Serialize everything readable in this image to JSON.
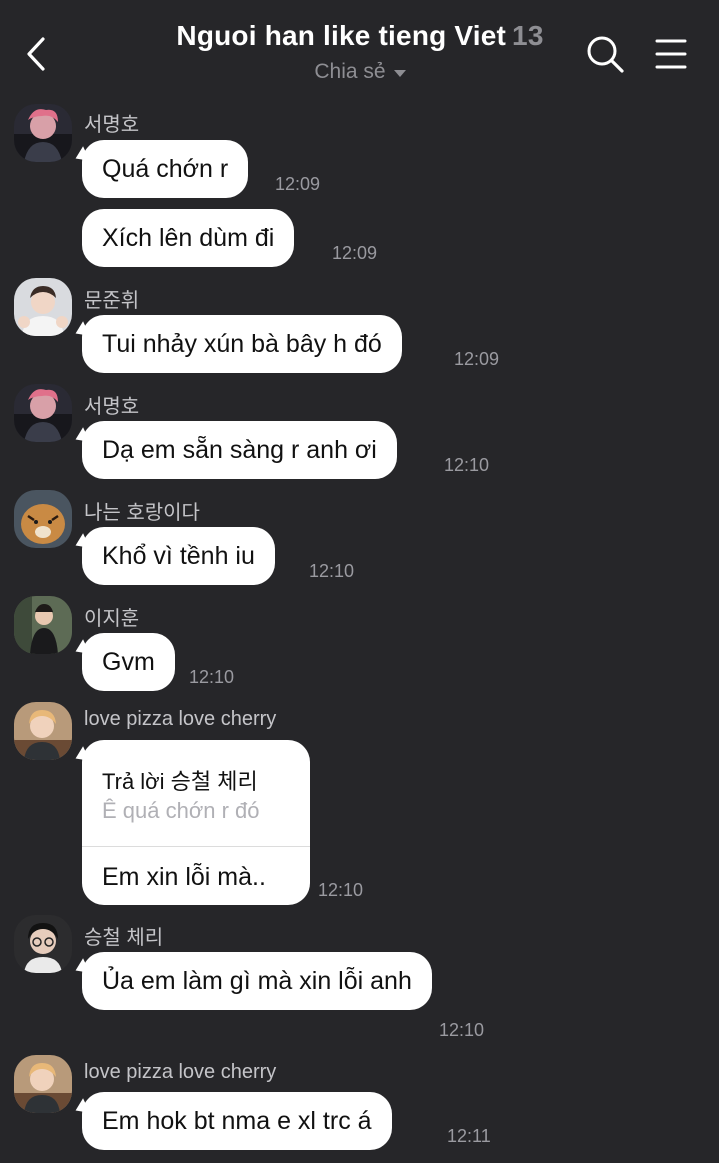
{
  "header": {
    "title": "Nguoi han like tieng Viet",
    "member_count": "13",
    "subtitle": "Chia sẻ",
    "icons": [
      "back-arrow-icon",
      "search-icon",
      "menu-icon"
    ]
  },
  "messages": [
    {
      "sender": "서명호",
      "text": "Quá chớn r",
      "time": "12:09"
    },
    {
      "text": "Xích lên dùm đi",
      "time": "12:09"
    },
    {
      "sender": "문준휘",
      "text": "Tui nhảy xún bà bây h đó",
      "time": "12:09"
    },
    {
      "sender": "서명호",
      "text": "Dạ em sẵn sàng r anh ơi",
      "time": "12:10"
    },
    {
      "sender": "나는 호랑이다",
      "text": "Khổ vì tềnh iu",
      "time": "12:10"
    },
    {
      "sender": "이지훈",
      "text": "Gvm",
      "time": "12:10"
    },
    {
      "sender": "love pizza love cherry",
      "reply_to": "Trả lời 승철 체리",
      "reply_quote": "Ê quá chớn r đó",
      "text": "Em xin lỗi mà..",
      "time": "12:10"
    },
    {
      "sender": "승철 체리",
      "text": "Ủa em làm gì mà xin lỗi anh",
      "time": "12:10"
    },
    {
      "sender": "love pizza love cherry",
      "text": "Em hok bt nma e xl trc á",
      "time": "12:11"
    }
  ],
  "colors": {
    "background": "#262629",
    "bubble": "#ffffff",
    "muted": "#8e8e93"
  }
}
